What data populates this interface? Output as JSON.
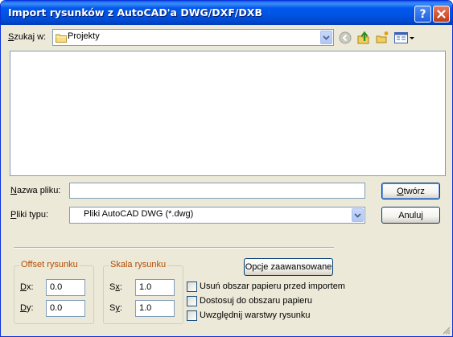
{
  "window": {
    "title": "Import rysunków z AutoCAD'a DWG/DXF/DXB",
    "help_glyph": "?",
    "close_glyph": "✕"
  },
  "lookin": {
    "label_hotkey": "S",
    "label_rest": "zukaj w:",
    "value": "Projekty",
    "folder_icon": "folder-icon",
    "toolbar_icons": [
      "back-icon",
      "up-folder-icon",
      "new-folder-icon",
      "view-menu-icon"
    ]
  },
  "filename": {
    "label_hotkey": "N",
    "label_rest": "azwa pliku:",
    "value": ""
  },
  "filetype": {
    "label_hotkey": "P",
    "label_rest": "liki typu:",
    "value": "Pliki AutoCAD DWG (*.dwg)"
  },
  "buttons": {
    "open_hotkey": "O",
    "open_rest": "twórz",
    "cancel": "Anuluj",
    "advanced": "Opcje zaawansowane"
  },
  "offset": {
    "title": "Offset rysunku",
    "dx_hotkey": "D",
    "dx_rest": "x:",
    "dx_value": "0.0",
    "dy_hotkey": "D",
    "dy_rest": "y:",
    "dy_value": "0.0"
  },
  "scale": {
    "title": "Skala rysunku",
    "sx_prefix": "S",
    "sx_hotkey": "x",
    "sx_rest": ":",
    "sx_value": "1.0",
    "sy_prefix": "S",
    "sy_hotkey": "y",
    "sy_rest": ":",
    "sy_value": "1.0"
  },
  "options": [
    {
      "label": "Usuń obszar papieru przed importem",
      "checked": false
    },
    {
      "label": "Dostosuj do obszaru papieru",
      "checked": false
    },
    {
      "label": "Uwzględnij warstwy rysunku",
      "checked": false
    }
  ],
  "colors": {
    "titlebar": "#0054e3",
    "dialog_bg": "#ece9d8",
    "group_title": "#b34c00",
    "field_border": "#7f9db9"
  }
}
